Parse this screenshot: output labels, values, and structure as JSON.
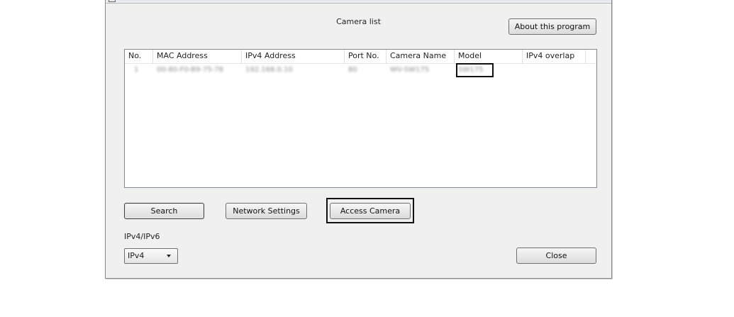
{
  "window": {
    "caption": "Camera list"
  },
  "buttons": {
    "about": "About this program",
    "search": "Search",
    "network_settings": "Network Settings",
    "access_camera": "Access Camera",
    "close": "Close"
  },
  "table": {
    "columns": [
      "No.",
      "MAC Address",
      "IPv4 Address",
      "Port No.",
      "Camera Name",
      "Model",
      "IPv4 overlap"
    ],
    "rows": [
      [
        "1",
        "00-80-F0-B9-75-78",
        "192.168.0.10",
        "80",
        "WV-SW175",
        "SW175",
        ""
      ]
    ]
  },
  "ip_mode": {
    "label": "IPv4/IPv6",
    "selected": "IPv4"
  },
  "icons": {
    "window_icon": "window-app-icon",
    "dropdown": "chevron-down-icon"
  },
  "colors": {
    "dialog_bg": "#f0f0f0",
    "list_bg": "#ffffff",
    "highlight": "#111111"
  }
}
